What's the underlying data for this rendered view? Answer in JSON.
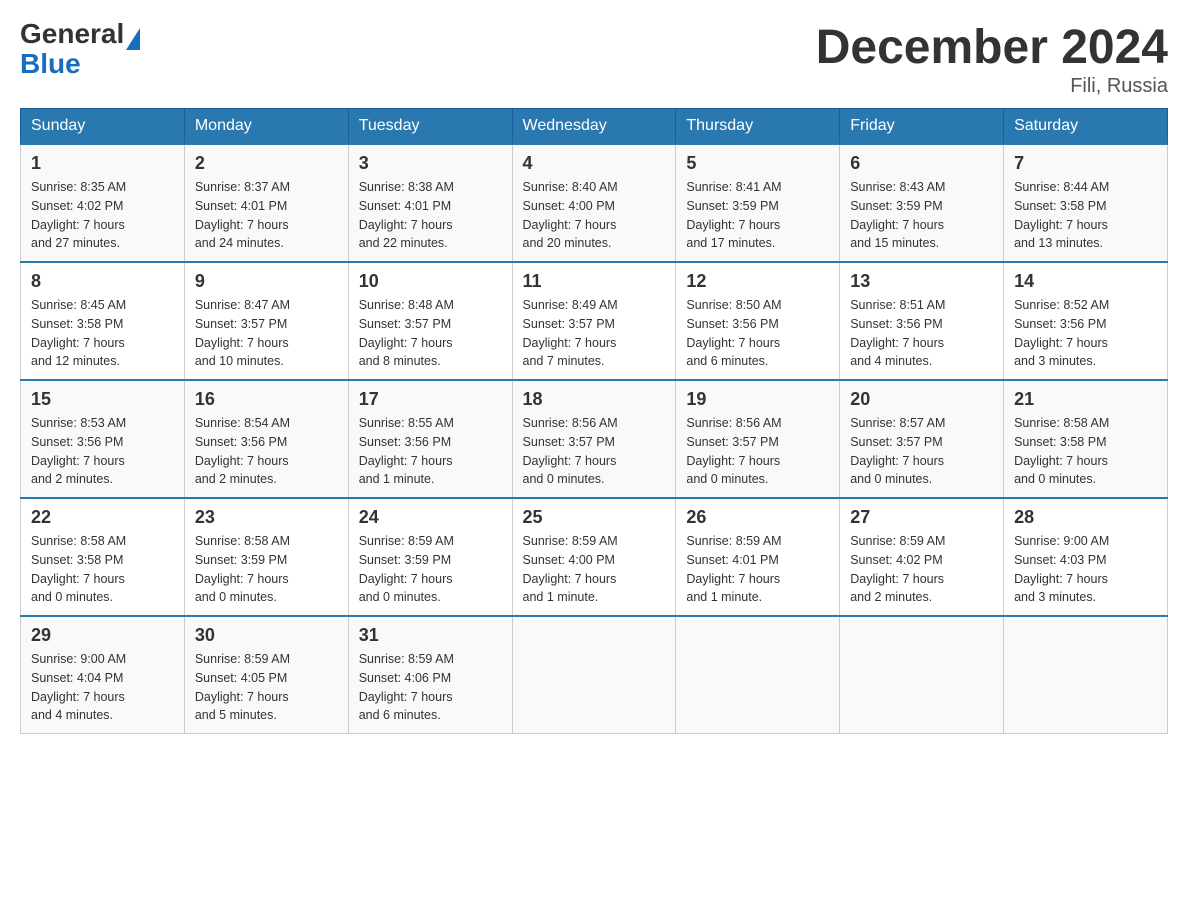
{
  "logo": {
    "text_general": "General",
    "text_blue": "Blue"
  },
  "header": {
    "month_title": "December 2024",
    "location": "Fili, Russia"
  },
  "weekdays": [
    "Sunday",
    "Monday",
    "Tuesday",
    "Wednesday",
    "Thursday",
    "Friday",
    "Saturday"
  ],
  "weeks": [
    [
      {
        "day": "1",
        "sunrise": "8:35 AM",
        "sunset": "4:02 PM",
        "daylight": "7 hours and 27 minutes."
      },
      {
        "day": "2",
        "sunrise": "8:37 AM",
        "sunset": "4:01 PM",
        "daylight": "7 hours and 24 minutes."
      },
      {
        "day": "3",
        "sunrise": "8:38 AM",
        "sunset": "4:01 PM",
        "daylight": "7 hours and 22 minutes."
      },
      {
        "day": "4",
        "sunrise": "8:40 AM",
        "sunset": "4:00 PM",
        "daylight": "7 hours and 20 minutes."
      },
      {
        "day": "5",
        "sunrise": "8:41 AM",
        "sunset": "3:59 PM",
        "daylight": "7 hours and 17 minutes."
      },
      {
        "day": "6",
        "sunrise": "8:43 AM",
        "sunset": "3:59 PM",
        "daylight": "7 hours and 15 minutes."
      },
      {
        "day": "7",
        "sunrise": "8:44 AM",
        "sunset": "3:58 PM",
        "daylight": "7 hours and 13 minutes."
      }
    ],
    [
      {
        "day": "8",
        "sunrise": "8:45 AM",
        "sunset": "3:58 PM",
        "daylight": "7 hours and 12 minutes."
      },
      {
        "day": "9",
        "sunrise": "8:47 AM",
        "sunset": "3:57 PM",
        "daylight": "7 hours and 10 minutes."
      },
      {
        "day": "10",
        "sunrise": "8:48 AM",
        "sunset": "3:57 PM",
        "daylight": "7 hours and 8 minutes."
      },
      {
        "day": "11",
        "sunrise": "8:49 AM",
        "sunset": "3:57 PM",
        "daylight": "7 hours and 7 minutes."
      },
      {
        "day": "12",
        "sunrise": "8:50 AM",
        "sunset": "3:56 PM",
        "daylight": "7 hours and 6 minutes."
      },
      {
        "day": "13",
        "sunrise": "8:51 AM",
        "sunset": "3:56 PM",
        "daylight": "7 hours and 4 minutes."
      },
      {
        "day": "14",
        "sunrise": "8:52 AM",
        "sunset": "3:56 PM",
        "daylight": "7 hours and 3 minutes."
      }
    ],
    [
      {
        "day": "15",
        "sunrise": "8:53 AM",
        "sunset": "3:56 PM",
        "daylight": "7 hours and 2 minutes."
      },
      {
        "day": "16",
        "sunrise": "8:54 AM",
        "sunset": "3:56 PM",
        "daylight": "7 hours and 2 minutes."
      },
      {
        "day": "17",
        "sunrise": "8:55 AM",
        "sunset": "3:56 PM",
        "daylight": "7 hours and 1 minute."
      },
      {
        "day": "18",
        "sunrise": "8:56 AM",
        "sunset": "3:57 PM",
        "daylight": "7 hours and 0 minutes."
      },
      {
        "day": "19",
        "sunrise": "8:56 AM",
        "sunset": "3:57 PM",
        "daylight": "7 hours and 0 minutes."
      },
      {
        "day": "20",
        "sunrise": "8:57 AM",
        "sunset": "3:57 PM",
        "daylight": "7 hours and 0 minutes."
      },
      {
        "day": "21",
        "sunrise": "8:58 AM",
        "sunset": "3:58 PM",
        "daylight": "7 hours and 0 minutes."
      }
    ],
    [
      {
        "day": "22",
        "sunrise": "8:58 AM",
        "sunset": "3:58 PM",
        "daylight": "7 hours and 0 minutes."
      },
      {
        "day": "23",
        "sunrise": "8:58 AM",
        "sunset": "3:59 PM",
        "daylight": "7 hours and 0 minutes."
      },
      {
        "day": "24",
        "sunrise": "8:59 AM",
        "sunset": "3:59 PM",
        "daylight": "7 hours and 0 minutes."
      },
      {
        "day": "25",
        "sunrise": "8:59 AM",
        "sunset": "4:00 PM",
        "daylight": "7 hours and 1 minute."
      },
      {
        "day": "26",
        "sunrise": "8:59 AM",
        "sunset": "4:01 PM",
        "daylight": "7 hours and 1 minute."
      },
      {
        "day": "27",
        "sunrise": "8:59 AM",
        "sunset": "4:02 PM",
        "daylight": "7 hours and 2 minutes."
      },
      {
        "day": "28",
        "sunrise": "9:00 AM",
        "sunset": "4:03 PM",
        "daylight": "7 hours and 3 minutes."
      }
    ],
    [
      {
        "day": "29",
        "sunrise": "9:00 AM",
        "sunset": "4:04 PM",
        "daylight": "7 hours and 4 minutes."
      },
      {
        "day": "30",
        "sunrise": "8:59 AM",
        "sunset": "4:05 PM",
        "daylight": "7 hours and 5 minutes."
      },
      {
        "day": "31",
        "sunrise": "8:59 AM",
        "sunset": "4:06 PM",
        "daylight": "7 hours and 6 minutes."
      },
      null,
      null,
      null,
      null
    ]
  ],
  "labels": {
    "sunrise": "Sunrise:",
    "sunset": "Sunset:",
    "daylight": "Daylight:"
  }
}
